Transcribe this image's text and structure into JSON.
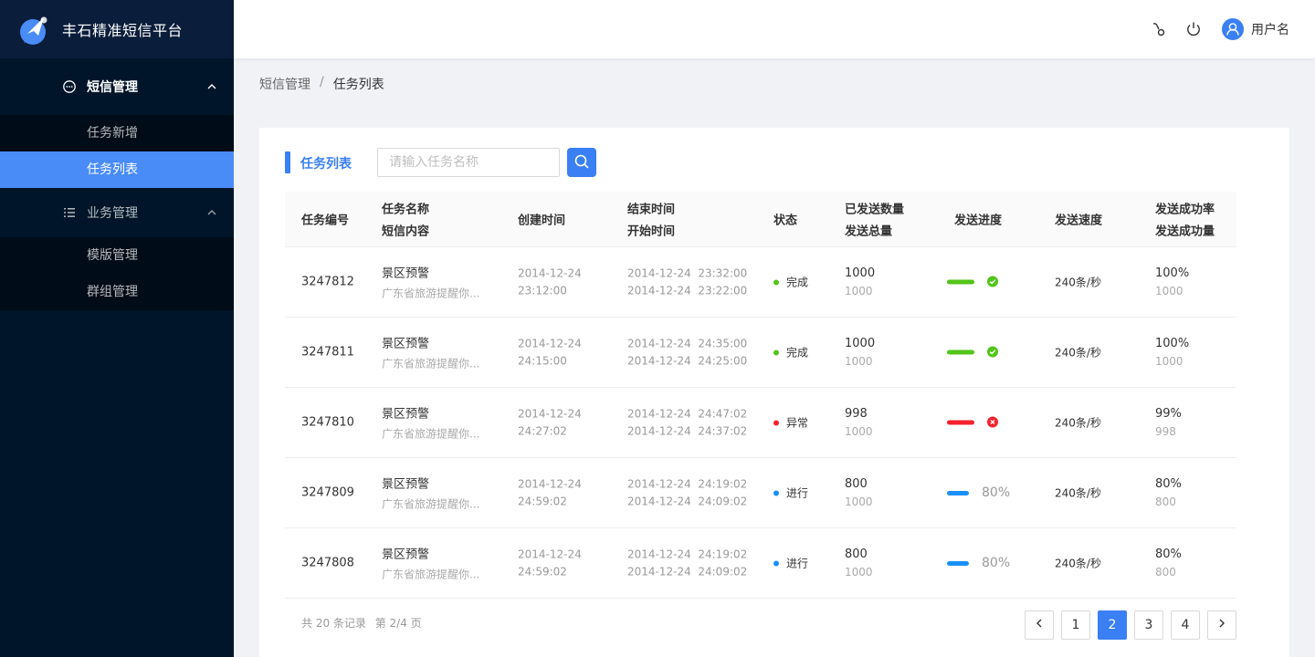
{
  "app": {
    "title": "丰石精准短信平台"
  },
  "colors": {
    "primary": "#3a7ff3",
    "success": "#52c41a",
    "error": "#f5222d",
    "processing": "#1890ff",
    "sidebar_bg": "#001529"
  },
  "sidebar": {
    "groups": [
      {
        "label": "短信管理",
        "icon": "message-icon",
        "expanded": true,
        "items": [
          {
            "label": "任务新增"
          },
          {
            "label": "任务列表",
            "active": true
          }
        ]
      },
      {
        "label": "业务管理",
        "icon": "list-icon",
        "expanded": true,
        "items": [
          {
            "label": "模版管理"
          },
          {
            "label": "群组管理"
          }
        ]
      }
    ]
  },
  "header": {
    "icons": [
      "link-icon",
      "power-icon"
    ],
    "user_name": "用户名"
  },
  "breadcrumb": {
    "items": [
      "短信管理",
      "任务列表"
    ],
    "separator": "/"
  },
  "card": {
    "title": "任务列表",
    "search": {
      "placeholder": "请输入任务名称",
      "value": ""
    }
  },
  "table": {
    "headers": {
      "id": "任务编号",
      "name": "任务名称",
      "content": "短信内容",
      "created": "创建时间",
      "end": "结束时间",
      "start": "开始时间",
      "status": "状态",
      "sent": "已发送数量",
      "total": "发送总量",
      "progress": "发送进度",
      "speed": "发送速度",
      "rate": "发送成功率",
      "success": "发送成功量"
    },
    "rows": [
      {
        "id": "3247812",
        "name": "景区预警",
        "content": "广东省旅游提醒你...",
        "created_date": "2014-12-24",
        "created_time": "23:12:00",
        "end": "2014-12-24  23:32:00",
        "start": "2014-12-24  23:22:00",
        "status": "完成",
        "status_color": "#52c41a",
        "sent": "1000",
        "total": "1000",
        "progress_state": "success",
        "progress_color": "#52c41a",
        "progress_pct": 100,
        "progress_label": "",
        "speed": "240条/秒",
        "rate": "100%",
        "success": "1000"
      },
      {
        "id": "3247811",
        "name": "景区预警",
        "content": "广东省旅游提醒你...",
        "created_date": "2014-12-24",
        "created_time": "24:15:00",
        "end": "2014-12-24  24:35:00",
        "start": "2014-12-24  24:25:00",
        "status": "完成",
        "status_color": "#52c41a",
        "sent": "1000",
        "total": "1000",
        "progress_state": "success",
        "progress_color": "#52c41a",
        "progress_pct": 100,
        "progress_label": "",
        "speed": "240条/秒",
        "rate": "100%",
        "success": "1000"
      },
      {
        "id": "3247810",
        "name": "景区预警",
        "content": "广东省旅游提醒你...",
        "created_date": "2014-12-24",
        "created_time": "24:27:02",
        "end": "2014-12-24  24:47:02",
        "start": "2014-12-24  24:37:02",
        "status": "异常",
        "status_color": "#f5222d",
        "sent": "998",
        "total": "1000",
        "progress_state": "error",
        "progress_color": "#f5222d",
        "progress_pct": 100,
        "progress_label": "",
        "speed": "240条/秒",
        "rate": "99%",
        "success": "998"
      },
      {
        "id": "3247809",
        "name": "景区预警",
        "content": "广东省旅游提醒你...",
        "created_date": "2014-12-24",
        "created_time": "24:59:02",
        "end": "2014-12-24  24:19:02",
        "start": "2014-12-24  24:09:02",
        "status": "进行",
        "status_color": "#1890ff",
        "sent": "800",
        "total": "1000",
        "progress_state": "active",
        "progress_color": "#1890ff",
        "progress_pct": 80,
        "progress_label": "80%",
        "speed": "240条/秒",
        "rate": "80%",
        "success": "800"
      },
      {
        "id": "3247808",
        "name": "景区预警",
        "content": "广东省旅游提醒你...",
        "created_date": "2014-12-24",
        "created_time": "24:59:02",
        "end": "2014-12-24  24:19:02",
        "start": "2014-12-24  24:09:02",
        "status": "进行",
        "status_color": "#1890ff",
        "sent": "800",
        "total": "1000",
        "progress_state": "active",
        "progress_color": "#1890ff",
        "progress_pct": 80,
        "progress_label": "80%",
        "speed": "240条/秒",
        "rate": "80%",
        "success": "800"
      }
    ]
  },
  "footer": {
    "total_records": "共 20 条记录",
    "page_info": "第 2/4 页",
    "pages": [
      "1",
      "2",
      "3",
      "4"
    ],
    "current_page": "2"
  }
}
